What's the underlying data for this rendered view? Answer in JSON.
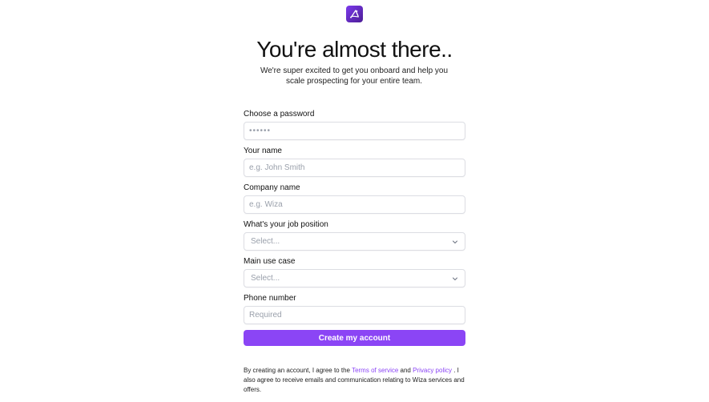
{
  "brand": {
    "logo_icon": "wiza-logo-icon",
    "accent_color": "#8b45f5"
  },
  "header": {
    "title": "You're almost there..",
    "subtitle": "We're super excited to get you onboard and help you scale prospecting for your entire team."
  },
  "form": {
    "password": {
      "label": "Choose a password",
      "value": "••••••",
      "placeholder": ""
    },
    "name": {
      "label": "Your name",
      "placeholder": "e.g. John Smith"
    },
    "company": {
      "label": "Company name",
      "placeholder": "e.g. Wiza"
    },
    "job_position": {
      "label": "What's your job position",
      "selected": "Select..."
    },
    "use_case": {
      "label": "Main use case",
      "selected": "Select..."
    },
    "phone": {
      "label": "Phone number",
      "placeholder": "Required"
    },
    "submit_label": "Create my account"
  },
  "terms": {
    "prefix": "By creating an account, I agree to the ",
    "terms_link": "Terms of service",
    "middle": " and ",
    "privacy_link": "Privacy policy",
    "suffix": " . I also agree to receive emails and communication relating to Wiza services and offers."
  }
}
